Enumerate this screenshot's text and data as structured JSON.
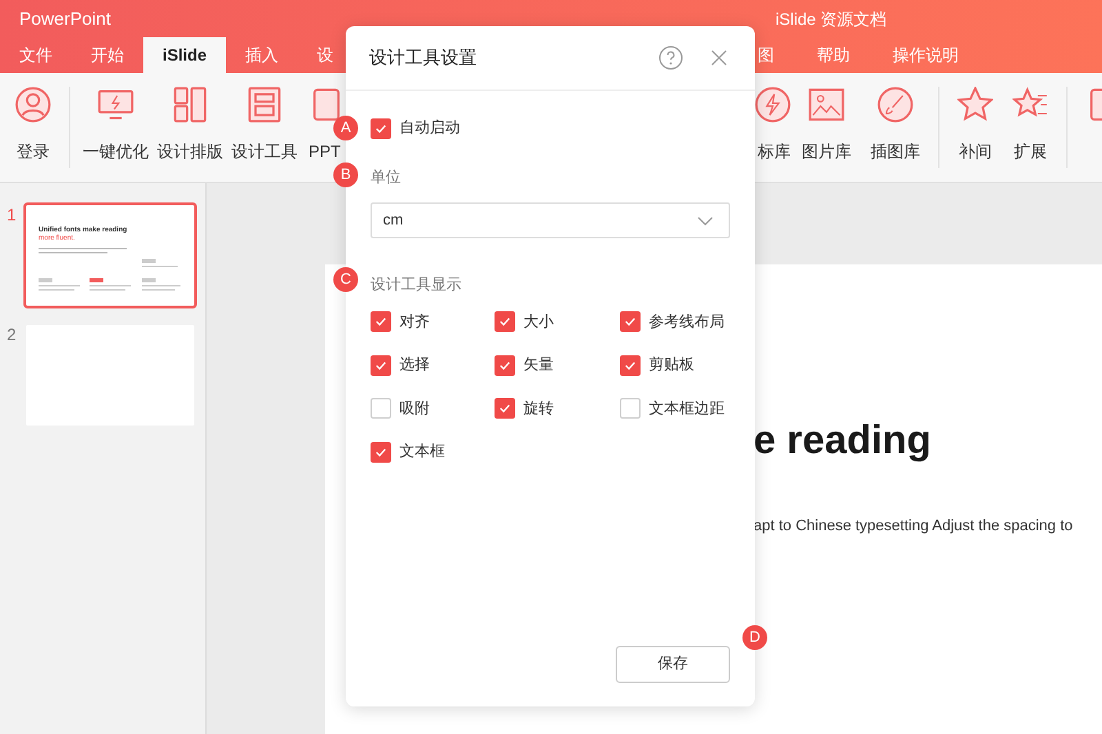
{
  "app": {
    "title": "PowerPoint",
    "document_title": "iSlide 资源文档"
  },
  "tabs_left": [
    {
      "label": "文件",
      "selected": false
    },
    {
      "label": "开始",
      "selected": false
    },
    {
      "label": "iSlide",
      "selected": true
    },
    {
      "label": "插入",
      "selected": false
    },
    {
      "label": "设",
      "selected": false
    }
  ],
  "tabs_right": [
    {
      "label": "图",
      "selected": false
    },
    {
      "label": "帮助",
      "selected": false
    },
    {
      "label": "操作说明",
      "selected": false
    }
  ],
  "ribbon_left": [
    {
      "kind": "user",
      "label": "登录"
    },
    {
      "kind": "divider"
    },
    {
      "kind": "monitor",
      "label": "一键优化"
    },
    {
      "kind": "columns",
      "label": "设计排版"
    },
    {
      "kind": "panel",
      "label": "设计工具"
    },
    {
      "kind": "doc",
      "label": "PPT"
    }
  ],
  "ribbon_right": [
    {
      "kind": "bolt",
      "label": "标库"
    },
    {
      "kind": "image",
      "label": "图片库"
    },
    {
      "kind": "brush",
      "label": "插图库"
    },
    {
      "kind": "divider"
    },
    {
      "kind": "star",
      "label": "补间"
    },
    {
      "kind": "starlist",
      "label": "扩展"
    },
    {
      "kind": "divider"
    },
    {
      "kind": "doc"
    }
  ],
  "slides": [
    {
      "number": "1",
      "selected": true,
      "title": "Unified fonts make reading",
      "highlight": "more fluent."
    },
    {
      "number": "2",
      "selected": false
    }
  ],
  "slide": {
    "heading": "e reading",
    "body": "apt to Chinese typesetting Adjust the spacing to"
  },
  "dialog": {
    "title": "设计工具设置",
    "auto_start": {
      "label": "自动启动",
      "checked": true
    },
    "unit": {
      "label": "单位",
      "value": "cm"
    },
    "display": {
      "label": "设计工具显示",
      "options": [
        {
          "label": "对齐",
          "checked": true
        },
        {
          "label": "大小",
          "checked": true
        },
        {
          "label": "参考线布局",
          "checked": true
        },
        {
          "label": "选择",
          "checked": true
        },
        {
          "label": "矢量",
          "checked": true
        },
        {
          "label": "剪贴板",
          "checked": true
        },
        {
          "label": "吸附",
          "checked": false
        },
        {
          "label": "旋转",
          "checked": true
        },
        {
          "label": "文本框边距",
          "checked": false
        },
        {
          "label": "文本框",
          "checked": true
        }
      ]
    },
    "save": "保存"
  },
  "markers": [
    "A",
    "B",
    "C",
    "D"
  ]
}
